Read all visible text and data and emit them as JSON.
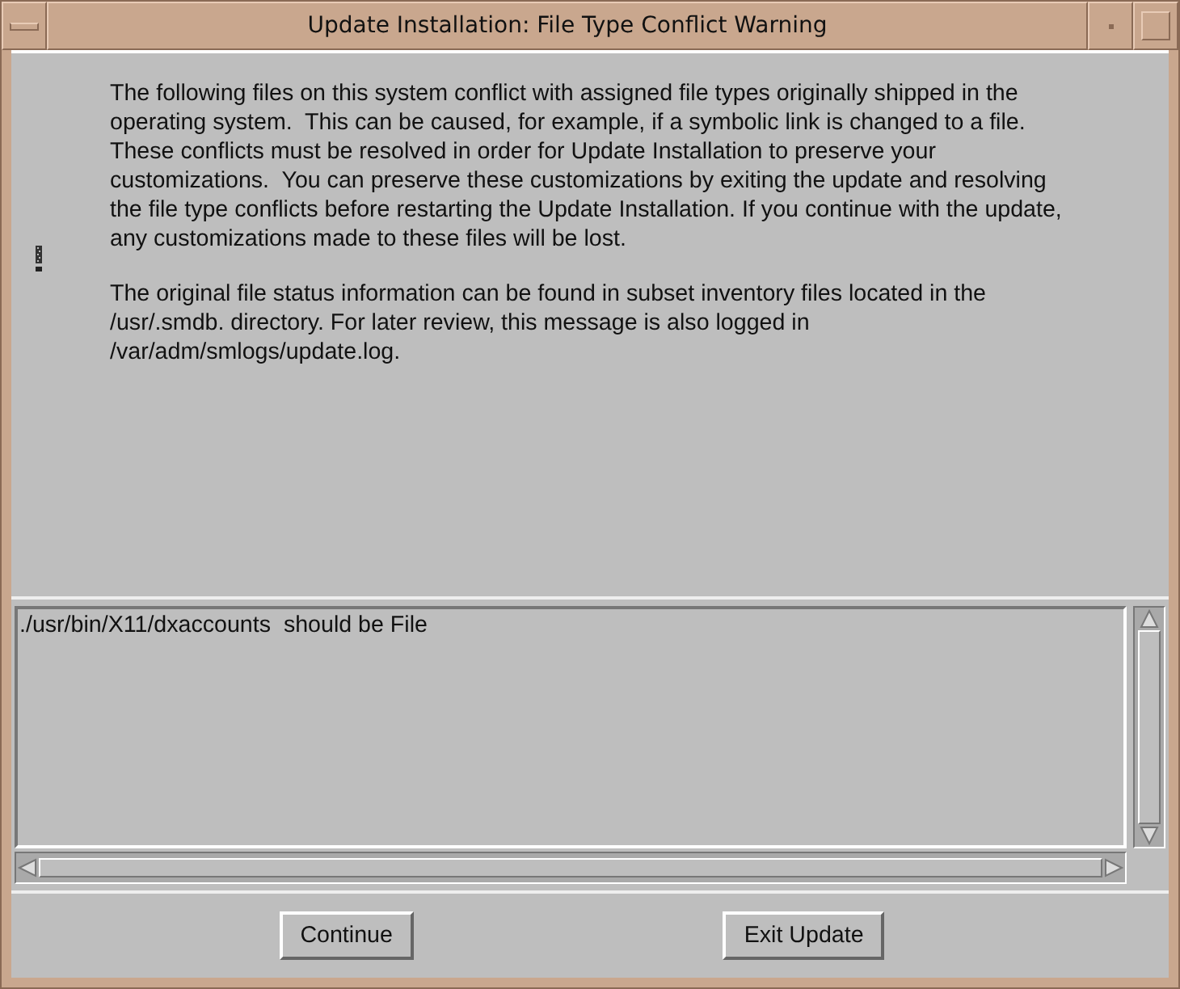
{
  "window": {
    "title": "Update Installation: File Type Conflict Warning"
  },
  "message": {
    "paragraphs": [
      "The following files on this system conflict with assigned file types originally shipped in the operating system.  This can be caused, for example, if a symbolic link is changed to a file.  These conflicts must be resolved in order for Update Installation to preserve your customizations.  You can preserve these customizations by exiting the update and resolving the file type conflicts before restarting the Update Installation. If you continue with the update, any customizations made to these files will be lost.",
      "The original file status information can be found in subset inventory files located in the /usr/.smdb. directory. For later review, this message is also logged in /var/adm/smlogs/update.log."
    ]
  },
  "list": {
    "items": [
      "./usr/bin/X11/dxaccounts  should be File"
    ]
  },
  "buttons": [
    "Continue",
    "Exit Update"
  ]
}
